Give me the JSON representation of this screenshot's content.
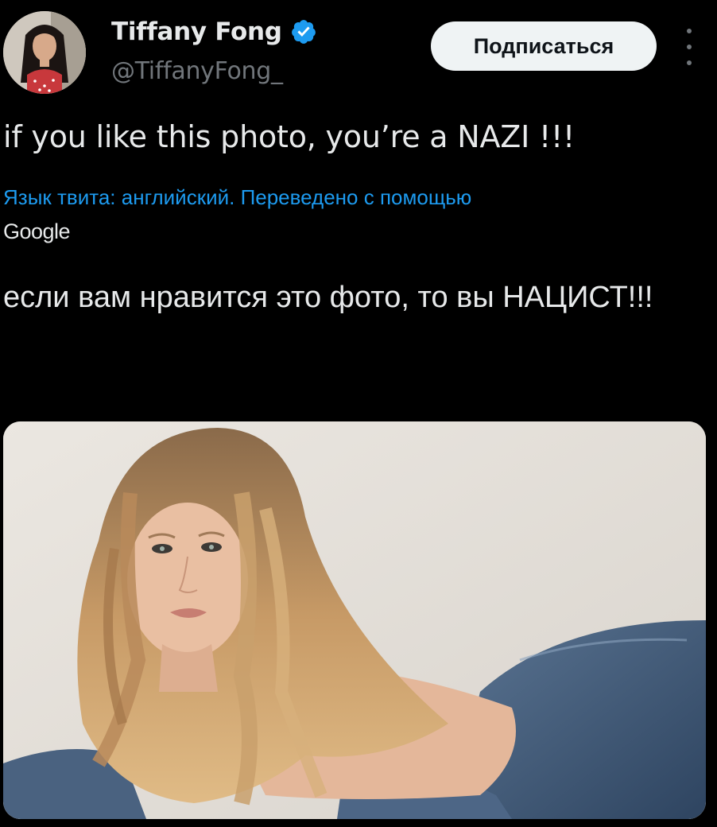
{
  "author": {
    "display_name": "Tiffany Fong",
    "handle": "@TiffanyFong_",
    "verified": true
  },
  "actions": {
    "follow_label": "Подписаться"
  },
  "tweet": {
    "text": "if you like this photo, you’re a NAZI !!!",
    "translation_note": "Язык твита: английский. Переведено с помощью",
    "translation_provider": "Google",
    "translated_text": "если вам нравится это фото, то вы НАЦИСТ!!!"
  },
  "icons": {
    "verified": "verified-badge-icon",
    "more": "more-options-icon"
  },
  "colors": {
    "background": "#000000",
    "text_primary": "#e7e9ea",
    "text_secondary": "#71767b",
    "link": "#1d9bf0",
    "follow_button_bg": "#eff3f4"
  }
}
